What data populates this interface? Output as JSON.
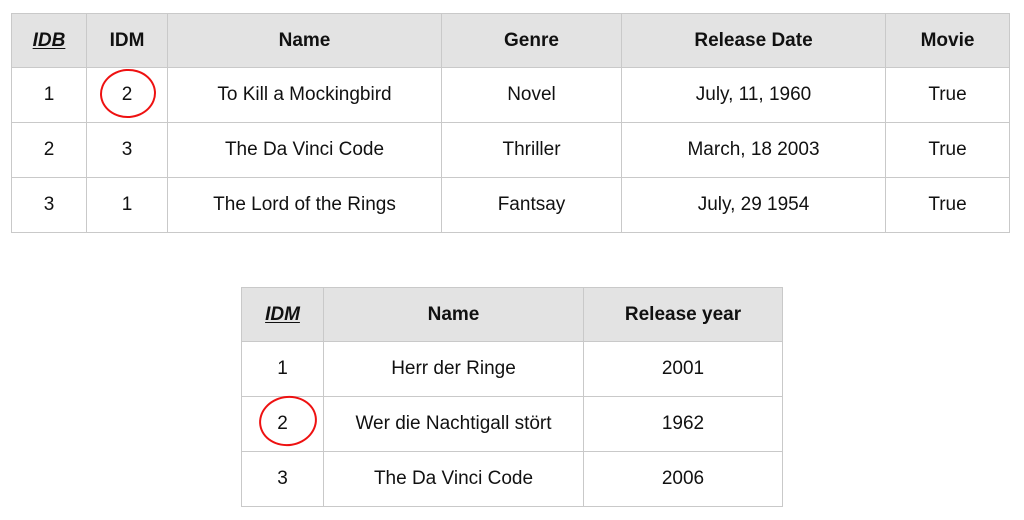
{
  "colors": {
    "header_background": "#e3e3e3",
    "cell_background": "#ffffff",
    "border": "#c9c9c9",
    "text": "#111111",
    "annotation_red": "#ee1111",
    "page_background": "#ffffff"
  },
  "tables": [
    {
      "id": "books-table",
      "columns": [
        {
          "label": "IDB",
          "primary_key": true
        },
        {
          "label": "IDM",
          "primary_key": false
        },
        {
          "label": "Name",
          "primary_key": false
        },
        {
          "label": "Genre",
          "primary_key": false
        },
        {
          "label": "Release Date",
          "primary_key": false
        },
        {
          "label": "Movie",
          "primary_key": false
        }
      ],
      "rows": [
        {
          "idb": "1",
          "idm": "2",
          "name": "To Kill a Mockingbird",
          "genre": "Novel",
          "release_date": "July, 11, 1960",
          "movie": "True"
        },
        {
          "idb": "2",
          "idm": "3",
          "name": "The Da Vinci Code",
          "genre": "Thriller",
          "release_date": "March, 18 2003",
          "movie": "True"
        },
        {
          "idb": "3",
          "idm": "1",
          "name": "The Lord of the Rings",
          "genre": "Fantsay",
          "release_date": "July, 29 1954",
          "movie": "True"
        }
      ]
    },
    {
      "id": "movies-table",
      "columns": [
        {
          "label": "IDM",
          "primary_key": true
        },
        {
          "label": "Name",
          "primary_key": false
        },
        {
          "label": "Release year",
          "primary_key": false
        }
      ],
      "rows": [
        {
          "idm": "1",
          "name": "Herr der Ringe",
          "release_year": "2001"
        },
        {
          "idm": "2",
          "name": "Wer die Nachtigall stört",
          "release_year": "1962"
        },
        {
          "idm": "3",
          "name": "The Da Vinci Code",
          "release_year": "2006"
        }
      ]
    }
  ],
  "annotations": [
    {
      "name": "circle-highlight-idm-books",
      "shape": "ellipse",
      "color": "#ee1111",
      "target_value": "2",
      "table": "books-table",
      "column": "IDM",
      "row_index": 0
    },
    {
      "name": "circle-highlight-idm-movies",
      "shape": "ellipse",
      "color": "#ee1111",
      "target_value": "2",
      "table": "movies-table",
      "column": "IDM",
      "row_index": 1
    }
  ]
}
